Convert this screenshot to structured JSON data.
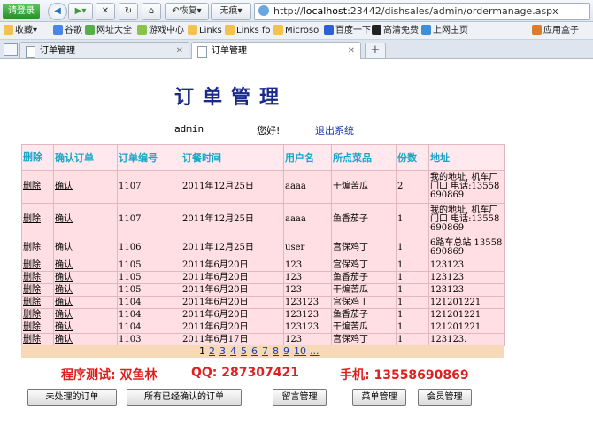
{
  "browser": {
    "login_label": "请登录",
    "restore_label": "恢复",
    "no_trace_label": "无痕",
    "url_prefix": "http://",
    "url_host": "localhost",
    "url_rest": ":23442/dishsales/admin/ordermanage.aspx",
    "favorites_label": "收藏",
    "favorites": [
      "谷歌",
      "网址大全",
      "游戏中心",
      "Links",
      "Links fo",
      "Microso",
      "百度一下",
      "高清免费",
      "上网主页"
    ],
    "app_box_label": "应用盒子",
    "tabs": [
      "订单管理",
      "订单管理"
    ]
  },
  "page": {
    "title": "订单管理",
    "username": "admin",
    "greeting": "您好!",
    "logout_label": "退出系统"
  },
  "table": {
    "headers": [
      "删除",
      "确认订单",
      "订单编号",
      "订餐时间",
      "用户名",
      "所点菜品",
      "份数",
      "地址"
    ],
    "rows": [
      {
        "delete": "删除",
        "confirm": "确认",
        "order_no": "1107",
        "time": "2011年12月25日",
        "user": "aaaa",
        "dish": "干煸苦瓜",
        "qty": "2",
        "address": "我的地址, 机车厂门口 电话:13558690869"
      },
      {
        "delete": "删除",
        "confirm": "确认",
        "order_no": "1107",
        "time": "2011年12月25日",
        "user": "aaaa",
        "dish": "鱼香茄子",
        "qty": "1",
        "address": "我的地址, 机车厂门口 电话:13558690869"
      },
      {
        "delete": "删除",
        "confirm": "确认",
        "order_no": "1106",
        "time": "2011年12月25日",
        "user": "user",
        "dish": "宫保鸡丁",
        "qty": "1",
        "address": "6路车总站 13558690869"
      },
      {
        "delete": "删除",
        "confirm": "确认",
        "order_no": "1105",
        "time": "2011年6月20日",
        "user": "123",
        "dish": "宫保鸡丁",
        "qty": "1",
        "address": "123123"
      },
      {
        "delete": "删除",
        "confirm": "确认",
        "order_no": "1105",
        "time": "2011年6月20日",
        "user": "123",
        "dish": "鱼香茄子",
        "qty": "1",
        "address": "123123"
      },
      {
        "delete": "删除",
        "confirm": "确认",
        "order_no": "1105",
        "time": "2011年6月20日",
        "user": "123",
        "dish": "干煸苦瓜",
        "qty": "1",
        "address": "123123"
      },
      {
        "delete": "删除",
        "confirm": "确认",
        "order_no": "1104",
        "time": "2011年6月20日",
        "user": "123123",
        "dish": "宫保鸡丁",
        "qty": "1",
        "address": "121201221"
      },
      {
        "delete": "删除",
        "confirm": "确认",
        "order_no": "1104",
        "time": "2011年6月20日",
        "user": "123123",
        "dish": "鱼香茄子",
        "qty": "1",
        "address": "121201221"
      },
      {
        "delete": "删除",
        "confirm": "确认",
        "order_no": "1104",
        "time": "2011年6月20日",
        "user": "123123",
        "dish": "干煸苦瓜",
        "qty": "1",
        "address": "121201221"
      },
      {
        "delete": "删除",
        "confirm": "确认",
        "order_no": "1103",
        "time": "2011年6月17日",
        "user": "123",
        "dish": "宫保鸡丁",
        "qty": "1",
        "address": "123123."
      }
    ]
  },
  "pager": {
    "current": "1",
    "pages": [
      "2",
      "3",
      "4",
      "5",
      "6",
      "7",
      "8",
      "9",
      "10",
      "..."
    ]
  },
  "footer": {
    "tester": "程序测试: 双鱼林",
    "qq": "QQ: 287307421",
    "phone": "手机: 13558690869"
  },
  "buttons": [
    "未处理的订单",
    "所有已经确认的订单",
    "留言管理",
    "菜单管理",
    "会员管理"
  ]
}
